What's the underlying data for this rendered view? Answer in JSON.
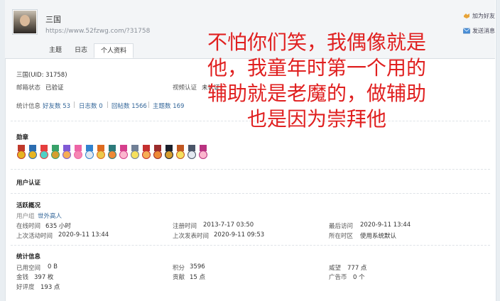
{
  "header": {
    "username": "三国",
    "profile_url": "https://www.52fzwg.com/?31758",
    "add_friend": "加为好友",
    "send_message": "发送消息",
    "tabs": [
      {
        "label": "主题"
      },
      {
        "label": "日志"
      },
      {
        "label": "个人资料",
        "active": true
      }
    ]
  },
  "profile": {
    "name_uid": "三国(UID: 31758)",
    "email_label": "邮箱状态",
    "email_value": "已验证",
    "video_label": "视频认证",
    "video_value": "未认证",
    "stats_label": "统计信息",
    "friends": "好友数 53",
    "logs": "日志数 0",
    "replies": "回帖数 1566",
    "threads": "主题数 169"
  },
  "medals": {
    "title": "勋章",
    "items": [
      {
        "icon": "medal-icon",
        "ribbon": "#c0392b",
        "coin": "#e6b422"
      },
      {
        "icon": "medal-icon",
        "ribbon": "#2b6cb0",
        "coin": "#e6b422"
      },
      {
        "icon": "medal-icon",
        "ribbon": "#e53e3e",
        "coin": "#4fd1c5"
      },
      {
        "icon": "medal-icon",
        "ribbon": "#38a169",
        "coin": "#d69e2e"
      },
      {
        "icon": "medal-icon",
        "ribbon": "#805ad5",
        "coin": "#f6ad55"
      },
      {
        "icon": "medal-icon",
        "ribbon": "#ed64a6",
        "coin": "#f687b3"
      },
      {
        "icon": "medal-icon",
        "ribbon": "#3182ce",
        "coin": "#e2e8f0"
      },
      {
        "icon": "medal-icon",
        "ribbon": "#dd6b20",
        "coin": "#ecc94b"
      },
      {
        "icon": "medal-icon",
        "ribbon": "#2c7a7b",
        "coin": "#ed8936"
      },
      {
        "icon": "medal-icon",
        "ribbon": "#d53f8c",
        "coin": "#fbb6ce"
      },
      {
        "icon": "medal-icon",
        "ribbon": "#718096",
        "coin": "#f6e05e"
      },
      {
        "icon": "medal-icon",
        "ribbon": "#c53030",
        "coin": "#f6ad55"
      },
      {
        "icon": "medal-icon",
        "ribbon": "#9b2c2c",
        "coin": "#ed8936"
      },
      {
        "icon": "medal-icon",
        "ribbon": "#1a202c",
        "coin": "#d69e2e"
      },
      {
        "icon": "medal-icon",
        "ribbon": "#c05621",
        "coin": "#f6e05e"
      },
      {
        "icon": "medal-icon",
        "ribbon": "#4a5568",
        "coin": "#e2e8f0"
      },
      {
        "icon": "medal-icon",
        "ribbon": "#b83280",
        "coin": "#fbb6ce"
      }
    ]
  },
  "user_auth": {
    "title": "用户认证"
  },
  "activity": {
    "title": "活跃概况",
    "group_label": "用户组",
    "group_value": "世外高人",
    "online_label": "在线时间",
    "online_value": "635 小时",
    "reg_label": "注册时间",
    "reg_value": "2013-7-17 03:50",
    "last_visit_label": "最后访问",
    "last_visit_value": "2020-9-11 13:44",
    "last_active_label": "上次活动时间",
    "last_active_value": "2020-9-11 13:44",
    "last_post_label": "上次发表时间",
    "last_post_value": "2020-9-11 09:53",
    "tz_label": "所在时区",
    "tz_value": "使用系统默认"
  },
  "stats": {
    "title": "统计信息",
    "space_label": "已用空间",
    "space_value": "0 B",
    "points_label": "积分",
    "points_value": "3596",
    "prestige_label": "威望",
    "prestige_value": "777 点",
    "money_label": "金钱",
    "money_value": "397 枚",
    "contrib_label": "贡献",
    "contrib_value": "15 点",
    "ad_label": "广告币",
    "ad_value": "0 个",
    "rating_label": "好评度",
    "rating_value": "193 点"
  },
  "overlay_text": [
    "不怕你们笑，我偶像就是",
    "他，我童年时第一个用的",
    "辅助就是老魔的，做辅助",
    "也是因为崇拜他"
  ],
  "colors": {
    "overlay": "#e02020",
    "link": "#336699"
  }
}
